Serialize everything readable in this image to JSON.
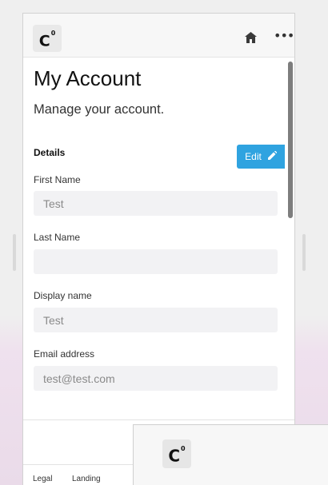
{
  "app": {
    "logo_text": "C",
    "logo_mark": "0"
  },
  "icons": {
    "home": "home-icon",
    "more": "more-icon"
  },
  "header": {
    "title": "My Account",
    "subtitle": "Manage your account."
  },
  "details": {
    "section_title": "Details",
    "edit_label": "Edit",
    "fields": [
      {
        "label": "First Name",
        "value": "Test"
      },
      {
        "label": "Last Name",
        "value": ""
      },
      {
        "label": "Display name",
        "value": "Test"
      },
      {
        "label": "Email address",
        "value": "test@test.com"
      }
    ]
  },
  "footer": {
    "links": [
      "Legal",
      "Landing"
    ]
  },
  "overlay_window": {
    "logo_text": "C",
    "logo_mark": "0"
  },
  "colors": {
    "accent": "#2fa3e0",
    "input_bg": "#f2f2f4",
    "background_pink": "#eadbe9"
  }
}
